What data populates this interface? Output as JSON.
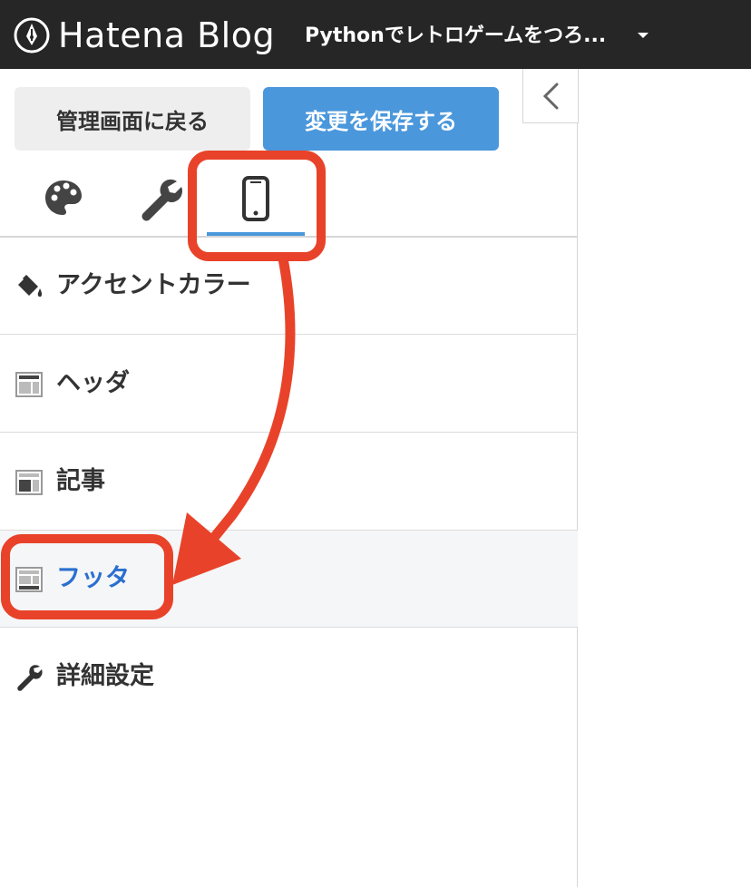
{
  "header": {
    "logo_text": "Hatena Blog",
    "blog_title": "Pythonでレトロゲームをつろ..."
  },
  "toolbar": {
    "back_label": "管理画面に戻る",
    "save_label": "変更を保存する"
  },
  "tabs": [
    {
      "name": "design",
      "icon": "palette-icon"
    },
    {
      "name": "customize",
      "icon": "wrench-icon"
    },
    {
      "name": "smartphone",
      "icon": "smartphone-icon",
      "active": true
    }
  ],
  "menu": {
    "items": [
      {
        "label": "アクセントカラー",
        "icon": "paint-bucket-icon"
      },
      {
        "label": "ヘッダ",
        "icon": "layout-header-icon"
      },
      {
        "label": "記事",
        "icon": "layout-article-icon"
      },
      {
        "label": "フッタ",
        "icon": "layout-footer-icon",
        "active": true
      },
      {
        "label": "詳細設定",
        "icon": "wrench-icon"
      }
    ]
  },
  "colors": {
    "topbar": "#262626",
    "accent": "#4a97dc",
    "active_text": "#2a6fcf",
    "annotation": "#e8432a"
  }
}
